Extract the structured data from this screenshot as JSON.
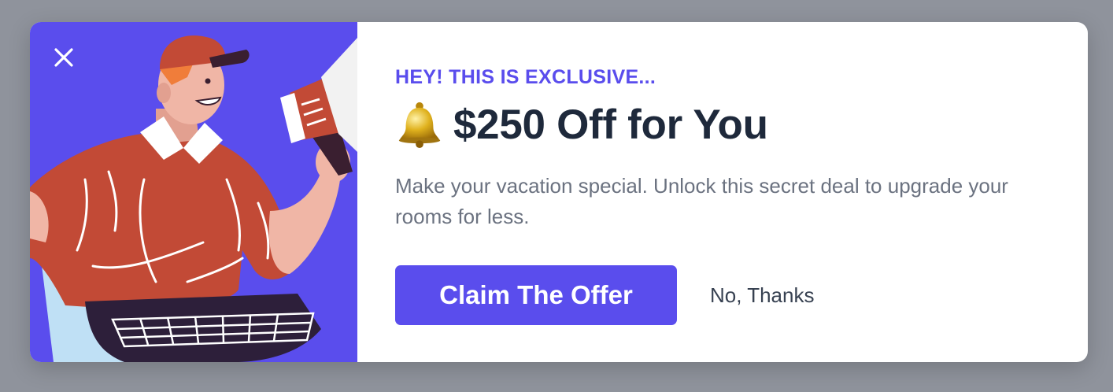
{
  "modal": {
    "eyebrow": "HEY! THIS IS EXCLUSIVE...",
    "headline": "$250 Off for You",
    "description": "Make your vacation special. Unlock this secret deal to upgrade your rooms for less.",
    "claim_label": "Claim The Offer",
    "dismiss_label": "No, Thanks",
    "close_icon": "close-icon",
    "headline_icon": "bell-icon"
  },
  "colors": {
    "accent": "#5a4ded",
    "headline": "#1e293b",
    "body_text": "#6b7280",
    "backdrop": "#8f939c"
  }
}
